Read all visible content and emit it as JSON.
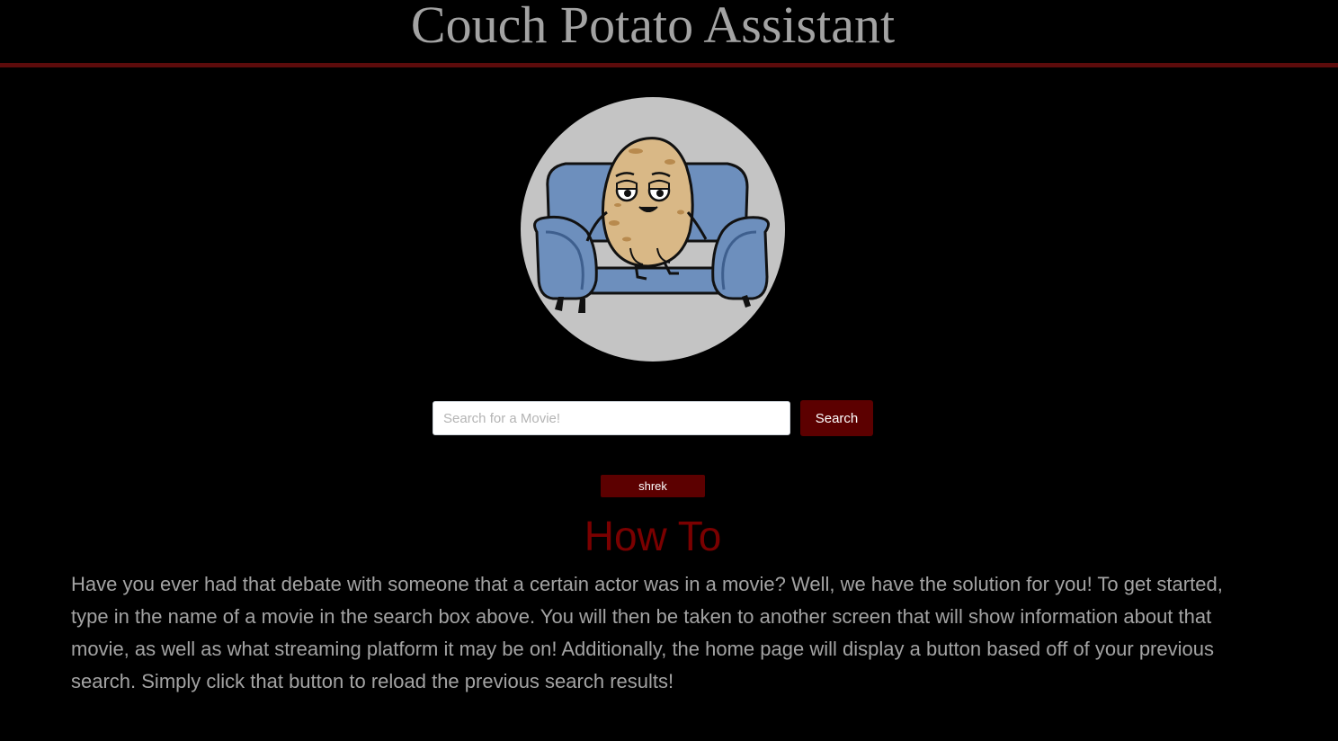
{
  "header": {
    "title": "Couch Potato Assistant"
  },
  "logo": {
    "icon": "couch-potato-logo",
    "background_color": "#c4c4c4",
    "couch_color": "#6d8fbd",
    "potato_color": "#d9b886"
  },
  "search": {
    "placeholder": "Search for a Movie!",
    "value": "",
    "button_label": "Search"
  },
  "history": {
    "previous_search_label": "shrek"
  },
  "how_to": {
    "title": "How To",
    "body": "Have you ever had that debate with someone that a certain actor was in a movie? Well, we have the solution for you! To get started, type in the name of a movie in the search box above. You will then be taken to another screen that will show information about that movie, as well as what streaming platform it may be on! Additionally, the home page will display a button based off of your previous search. Simply click that button to reload the previous search results!"
  },
  "colors": {
    "background": "#000000",
    "accent": "#5c0000",
    "title_text": "#a3a3a3",
    "howto_title": "#7a0000"
  }
}
